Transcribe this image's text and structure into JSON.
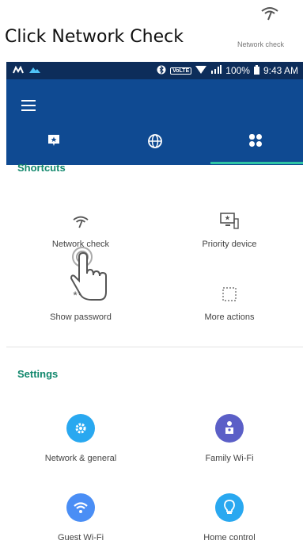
{
  "instruction": "Click Network Check",
  "corner_label": "Network check",
  "status": {
    "volte": "VoLTE",
    "battery": "100%",
    "time": "9:43 AM"
  },
  "tabs": [
    {
      "icon": "device-star-icon"
    },
    {
      "icon": "globe-icon"
    },
    {
      "icon": "apps-grid-icon"
    }
  ],
  "shortcuts": {
    "title": "Shortcuts",
    "items": [
      {
        "label": "Network check",
        "icon": "network-check-icon"
      },
      {
        "label": "Priority device",
        "icon": "priority-device-icon"
      },
      {
        "label": "Show password",
        "icon": "password-icon",
        "text": "***"
      },
      {
        "label": "More actions",
        "icon": "more-actions-icon"
      }
    ]
  },
  "settings": {
    "title": "Settings",
    "items": [
      {
        "label": "Network & general",
        "icon": "gear-icon",
        "color": "#29a8f0"
      },
      {
        "label": "Family Wi-Fi",
        "icon": "family-icon",
        "color": "#5b5fc7"
      },
      {
        "label": "Guest Wi-Fi",
        "icon": "wifi-icon",
        "color": "#4a8ef5"
      },
      {
        "label": "Home control",
        "icon": "bulb-icon",
        "color": "#29a8f0"
      }
    ]
  }
}
